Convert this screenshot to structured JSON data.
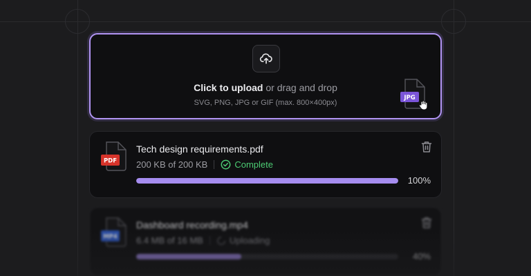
{
  "dropzone": {
    "title_bold": "Click to upload",
    "title_rest": " or drag and drop",
    "hint": "SVG, PNG, JPG or GIF (max. 800×400px)",
    "drag_file_badge": "JPG",
    "accent_color": "#b194f3"
  },
  "files": [
    {
      "name": "Tech design requirements.pdf",
      "badge": "PDF",
      "badge_color": "#d6332a",
      "size_text": "200 KB of 200 KB",
      "status": "Complete",
      "status_color": "#4ccb73",
      "progress": 100,
      "progress_label": "100%"
    },
    {
      "name": "Dashboard recording.mp4",
      "badge": "MP4",
      "badge_color": "#2f5fd6",
      "size_text": "6.4 MB of 16 MB",
      "status": "Uploading",
      "progress": 40,
      "progress_label": "40%"
    }
  ]
}
